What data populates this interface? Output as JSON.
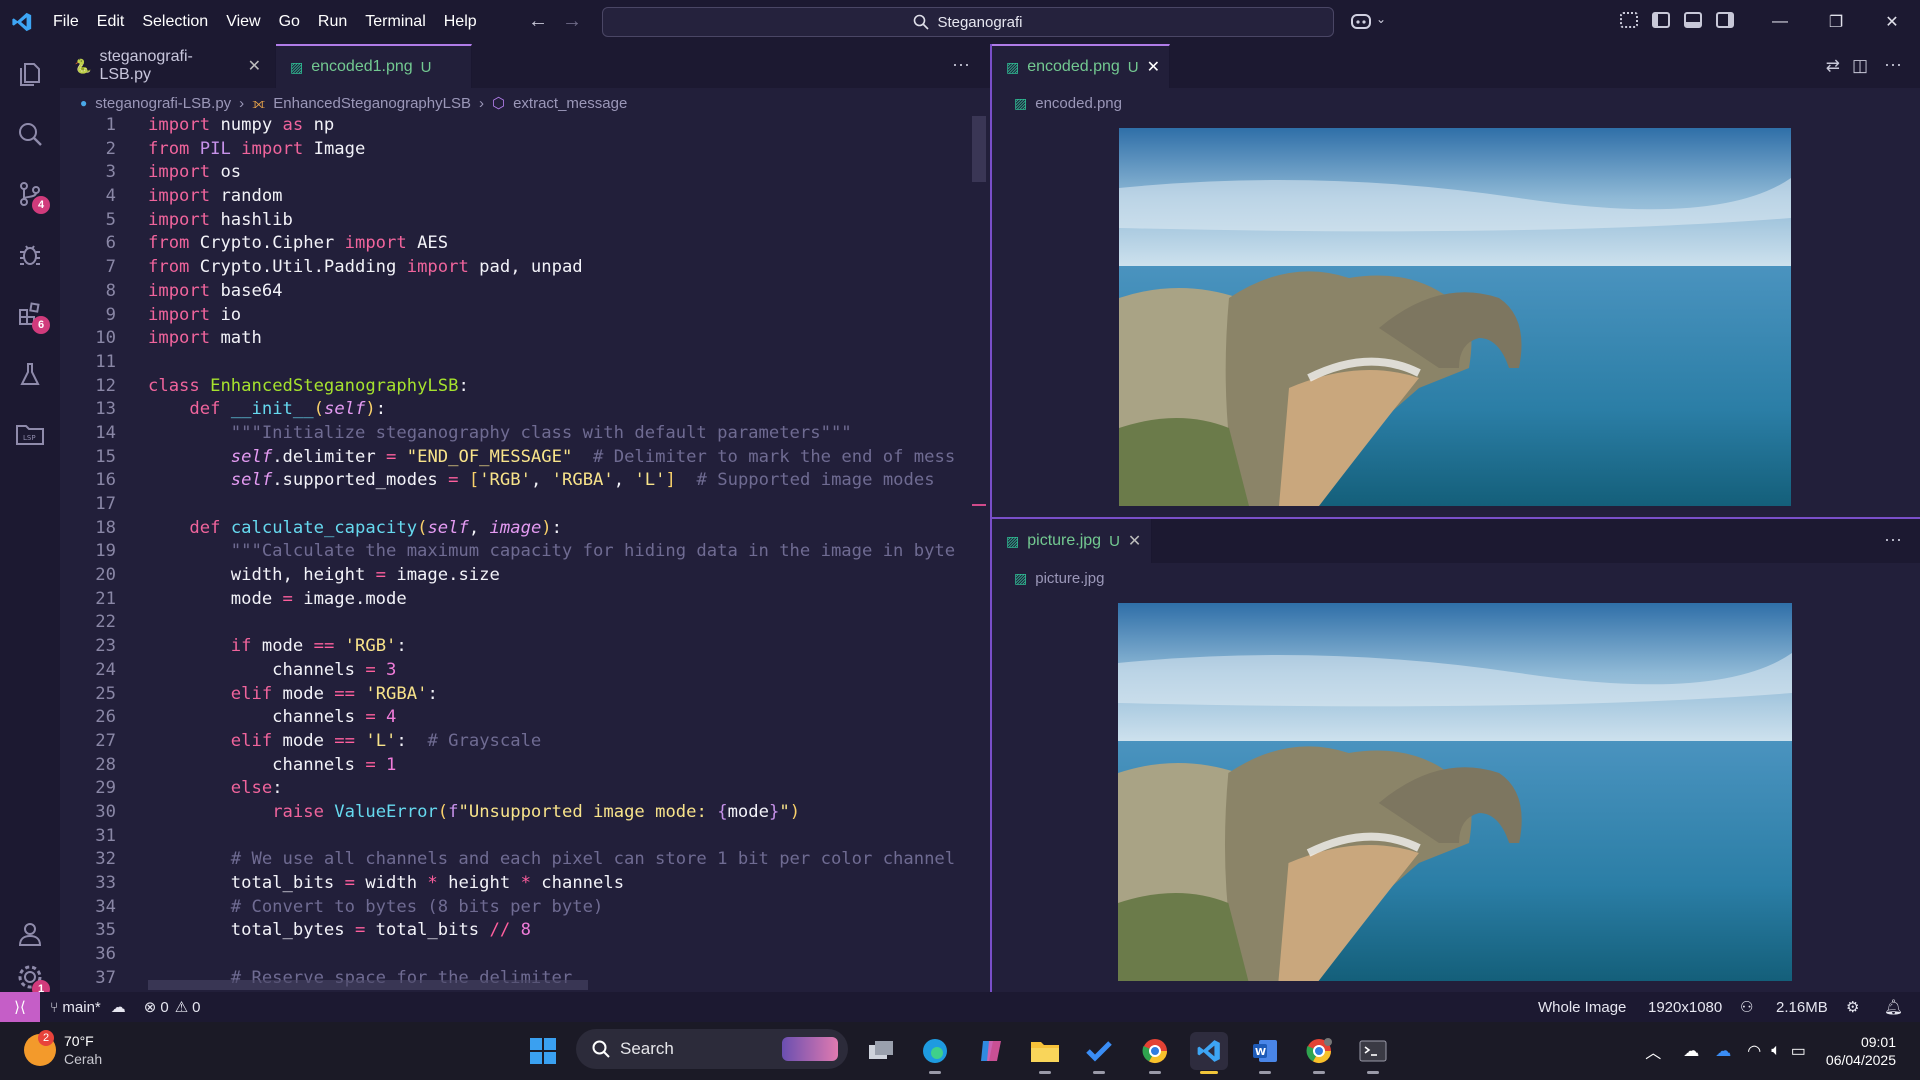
{
  "menu": [
    "File",
    "Edit",
    "Selection",
    "View",
    "Go",
    "Run",
    "Terminal",
    "Help"
  ],
  "search": {
    "text": "Steganografi"
  },
  "activity_badges": {
    "scm": "4",
    "extensions": "6",
    "settings": "1"
  },
  "editor_left": {
    "tabs": [
      {
        "label": "steganografi-LSB.py",
        "suffix": "",
        "close": "✕"
      },
      {
        "label": "encoded1.png",
        "suffix": "U",
        "close": ""
      }
    ],
    "more": "···",
    "breadcrumb": [
      "steganografi-LSB.py",
      "EnhancedSteganographyLSB",
      "extract_message"
    ]
  },
  "code_lines": [
    {
      "n": "1",
      "segs": [
        [
          "kw",
          "import"
        ],
        [
          "pl",
          " numpy "
        ],
        [
          "kw",
          "as"
        ],
        [
          "pl",
          " np"
        ]
      ]
    },
    {
      "n": "2",
      "segs": [
        [
          "kw",
          "from"
        ],
        [
          "pl",
          " "
        ],
        [
          "kw2",
          "PIL"
        ],
        [
          "pl",
          " "
        ],
        [
          "kw",
          "import"
        ],
        [
          "pl",
          " Image"
        ]
      ]
    },
    {
      "n": "3",
      "segs": [
        [
          "kw",
          "import"
        ],
        [
          "pl",
          " os"
        ]
      ]
    },
    {
      "n": "4",
      "segs": [
        [
          "kw",
          "import"
        ],
        [
          "pl",
          " random"
        ]
      ]
    },
    {
      "n": "5",
      "segs": [
        [
          "kw",
          "import"
        ],
        [
          "pl",
          " hashlib"
        ]
      ]
    },
    {
      "n": "6",
      "segs": [
        [
          "kw",
          "from"
        ],
        [
          "pl",
          " Crypto.Cipher "
        ],
        [
          "kw",
          "import"
        ],
        [
          "pl",
          " AES"
        ]
      ]
    },
    {
      "n": "7",
      "segs": [
        [
          "kw",
          "from"
        ],
        [
          "pl",
          " Crypto.Util.Padding "
        ],
        [
          "kw",
          "import"
        ],
        [
          "pl",
          " pad, unpad"
        ]
      ]
    },
    {
      "n": "8",
      "segs": [
        [
          "kw",
          "import"
        ],
        [
          "pl",
          " base64"
        ]
      ]
    },
    {
      "n": "9",
      "segs": [
        [
          "kw",
          "import"
        ],
        [
          "pl",
          " io"
        ]
      ]
    },
    {
      "n": "10",
      "segs": [
        [
          "kw",
          "import"
        ],
        [
          "pl",
          " math"
        ]
      ]
    },
    {
      "n": "11",
      "segs": []
    },
    {
      "n": "12",
      "segs": [
        [
          "kw",
          "class"
        ],
        [
          "pl",
          " "
        ],
        [
          "cls",
          "EnhancedSteganographyLSB"
        ],
        [
          "pl",
          ":"
        ]
      ]
    },
    {
      "n": "13",
      "segs": [
        [
          "pl",
          "    "
        ],
        [
          "kw",
          "def"
        ],
        [
          "pl",
          " "
        ],
        [
          "fn",
          "__init__"
        ],
        [
          "par",
          "("
        ],
        [
          "sf",
          "self"
        ],
        [
          "par",
          ")"
        ],
        [
          "pl",
          ":"
        ]
      ]
    },
    {
      "n": "14",
      "segs": [
        [
          "cm",
          "        \"\"\"Initialize steganography class with default parameters\"\"\""
        ]
      ]
    },
    {
      "n": "15",
      "segs": [
        [
          "pl",
          "        "
        ],
        [
          "sf",
          "self"
        ],
        [
          "pl",
          ".delimiter "
        ],
        [
          "op",
          "="
        ],
        [
          "pl",
          " "
        ],
        [
          "str",
          "\"END_OF_MESSAGE\""
        ],
        [
          "cm",
          "  # Delimiter to mark the end of mess"
        ]
      ]
    },
    {
      "n": "16",
      "segs": [
        [
          "pl",
          "        "
        ],
        [
          "sf",
          "self"
        ],
        [
          "pl",
          ".supported_modes "
        ],
        [
          "op",
          "="
        ],
        [
          "pl",
          " "
        ],
        [
          "par",
          "["
        ],
        [
          "str",
          "'RGB'"
        ],
        [
          "pl",
          ", "
        ],
        [
          "str",
          "'RGBA'"
        ],
        [
          "pl",
          ", "
        ],
        [
          "str",
          "'L'"
        ],
        [
          "par",
          "]"
        ],
        [
          "cm",
          "  # Supported image modes"
        ]
      ]
    },
    {
      "n": "17",
      "segs": []
    },
    {
      "n": "18",
      "segs": [
        [
          "pl",
          "    "
        ],
        [
          "kw",
          "def"
        ],
        [
          "pl",
          " "
        ],
        [
          "fn",
          "calculate_capacity"
        ],
        [
          "par",
          "("
        ],
        [
          "sf",
          "self"
        ],
        [
          "pl",
          ", "
        ],
        [
          "sf",
          "image"
        ],
        [
          "par",
          ")"
        ],
        [
          "pl",
          ":"
        ]
      ]
    },
    {
      "n": "19",
      "segs": [
        [
          "cm",
          "        \"\"\"Calculate the maximum capacity for hiding data in the image in byte"
        ]
      ]
    },
    {
      "n": "20",
      "segs": [
        [
          "pl",
          "        width, height "
        ],
        [
          "op",
          "="
        ],
        [
          "pl",
          " image.size"
        ]
      ]
    },
    {
      "n": "21",
      "segs": [
        [
          "pl",
          "        mode "
        ],
        [
          "op",
          "="
        ],
        [
          "pl",
          " image.mode"
        ]
      ]
    },
    {
      "n": "22",
      "segs": []
    },
    {
      "n": "23",
      "segs": [
        [
          "pl",
          "        "
        ],
        [
          "kw",
          "if"
        ],
        [
          "pl",
          " mode "
        ],
        [
          "op",
          "=="
        ],
        [
          "pl",
          " "
        ],
        [
          "str",
          "'RGB'"
        ],
        [
          "pl",
          ":"
        ]
      ]
    },
    {
      "n": "24",
      "segs": [
        [
          "pl",
          "            channels "
        ],
        [
          "op",
          "="
        ],
        [
          "pl",
          " "
        ],
        [
          "num",
          "3"
        ]
      ]
    },
    {
      "n": "25",
      "segs": [
        [
          "pl",
          "        "
        ],
        [
          "kw",
          "elif"
        ],
        [
          "pl",
          " mode "
        ],
        [
          "op",
          "=="
        ],
        [
          "pl",
          " "
        ],
        [
          "str",
          "'RGBA'"
        ],
        [
          "pl",
          ":"
        ]
      ]
    },
    {
      "n": "26",
      "segs": [
        [
          "pl",
          "            channels "
        ],
        [
          "op",
          "="
        ],
        [
          "pl",
          " "
        ],
        [
          "num",
          "4"
        ]
      ]
    },
    {
      "n": "27",
      "segs": [
        [
          "pl",
          "        "
        ],
        [
          "kw",
          "elif"
        ],
        [
          "pl",
          " mode "
        ],
        [
          "op",
          "=="
        ],
        [
          "pl",
          " "
        ],
        [
          "str",
          "'L'"
        ],
        [
          "pl",
          ":  "
        ],
        [
          "cm",
          "# Grayscale"
        ]
      ]
    },
    {
      "n": "28",
      "segs": [
        [
          "pl",
          "            channels "
        ],
        [
          "op",
          "="
        ],
        [
          "pl",
          " "
        ],
        [
          "num",
          "1"
        ]
      ]
    },
    {
      "n": "29",
      "segs": [
        [
          "pl",
          "        "
        ],
        [
          "kw",
          "else"
        ],
        [
          "pl",
          ":"
        ]
      ]
    },
    {
      "n": "30",
      "segs": [
        [
          "pl",
          "            "
        ],
        [
          "kw",
          "raise"
        ],
        [
          "pl",
          " "
        ],
        [
          "fn",
          "ValueError"
        ],
        [
          "par",
          "("
        ],
        [
          "kw2",
          "f"
        ],
        [
          "str",
          "\"Unsupported image mode: "
        ],
        [
          "kw2",
          "{"
        ],
        [
          "pl",
          "mode"
        ],
        [
          "kw2",
          "}"
        ],
        [
          "str",
          "\""
        ],
        [
          "par",
          ")"
        ]
      ]
    },
    {
      "n": "31",
      "segs": []
    },
    {
      "n": "32",
      "segs": [
        [
          "cm",
          "        # We use all channels and each pixel can store 1 bit per color channel"
        ]
      ]
    },
    {
      "n": "33",
      "segs": [
        [
          "pl",
          "        total_bits "
        ],
        [
          "op",
          "="
        ],
        [
          "pl",
          " width "
        ],
        [
          "op",
          "*"
        ],
        [
          "pl",
          " height "
        ],
        [
          "op",
          "*"
        ],
        [
          "pl",
          " channels"
        ]
      ]
    },
    {
      "n": "34",
      "segs": [
        [
          "cm",
          "        # Convert to bytes (8 bits per byte)"
        ]
      ]
    },
    {
      "n": "35",
      "segs": [
        [
          "pl",
          "        total_bytes "
        ],
        [
          "op",
          "="
        ],
        [
          "pl",
          " total_bits "
        ],
        [
          "op",
          "//"
        ],
        [
          "pl",
          " "
        ],
        [
          "num",
          "8"
        ]
      ]
    },
    {
      "n": "36",
      "segs": []
    },
    {
      "n": "37",
      "segs": [
        [
          "cm",
          "        # Reserve space for the delimiter"
        ]
      ]
    }
  ],
  "editor_top_right": {
    "tab": "encoded.png",
    "suffix": "U",
    "close": "✕",
    "crumb": "encoded.png"
  },
  "editor_bottom_right": {
    "tab": "picture.jpg",
    "suffix": "U",
    "close": "✕",
    "crumb": "picture.jpg",
    "more": "···"
  },
  "status": {
    "branch": "main*",
    "errors": "0",
    "warnings": "0",
    "zoom_mode": "Whole Image",
    "dimensions": "1920x1080",
    "size": "2.16MB"
  },
  "taskbar": {
    "weather_temp": "70°F",
    "weather_desc": "Cerah",
    "weather_badge": "2",
    "search_label": "Search",
    "time": "09:01",
    "date": "06/04/2025"
  }
}
